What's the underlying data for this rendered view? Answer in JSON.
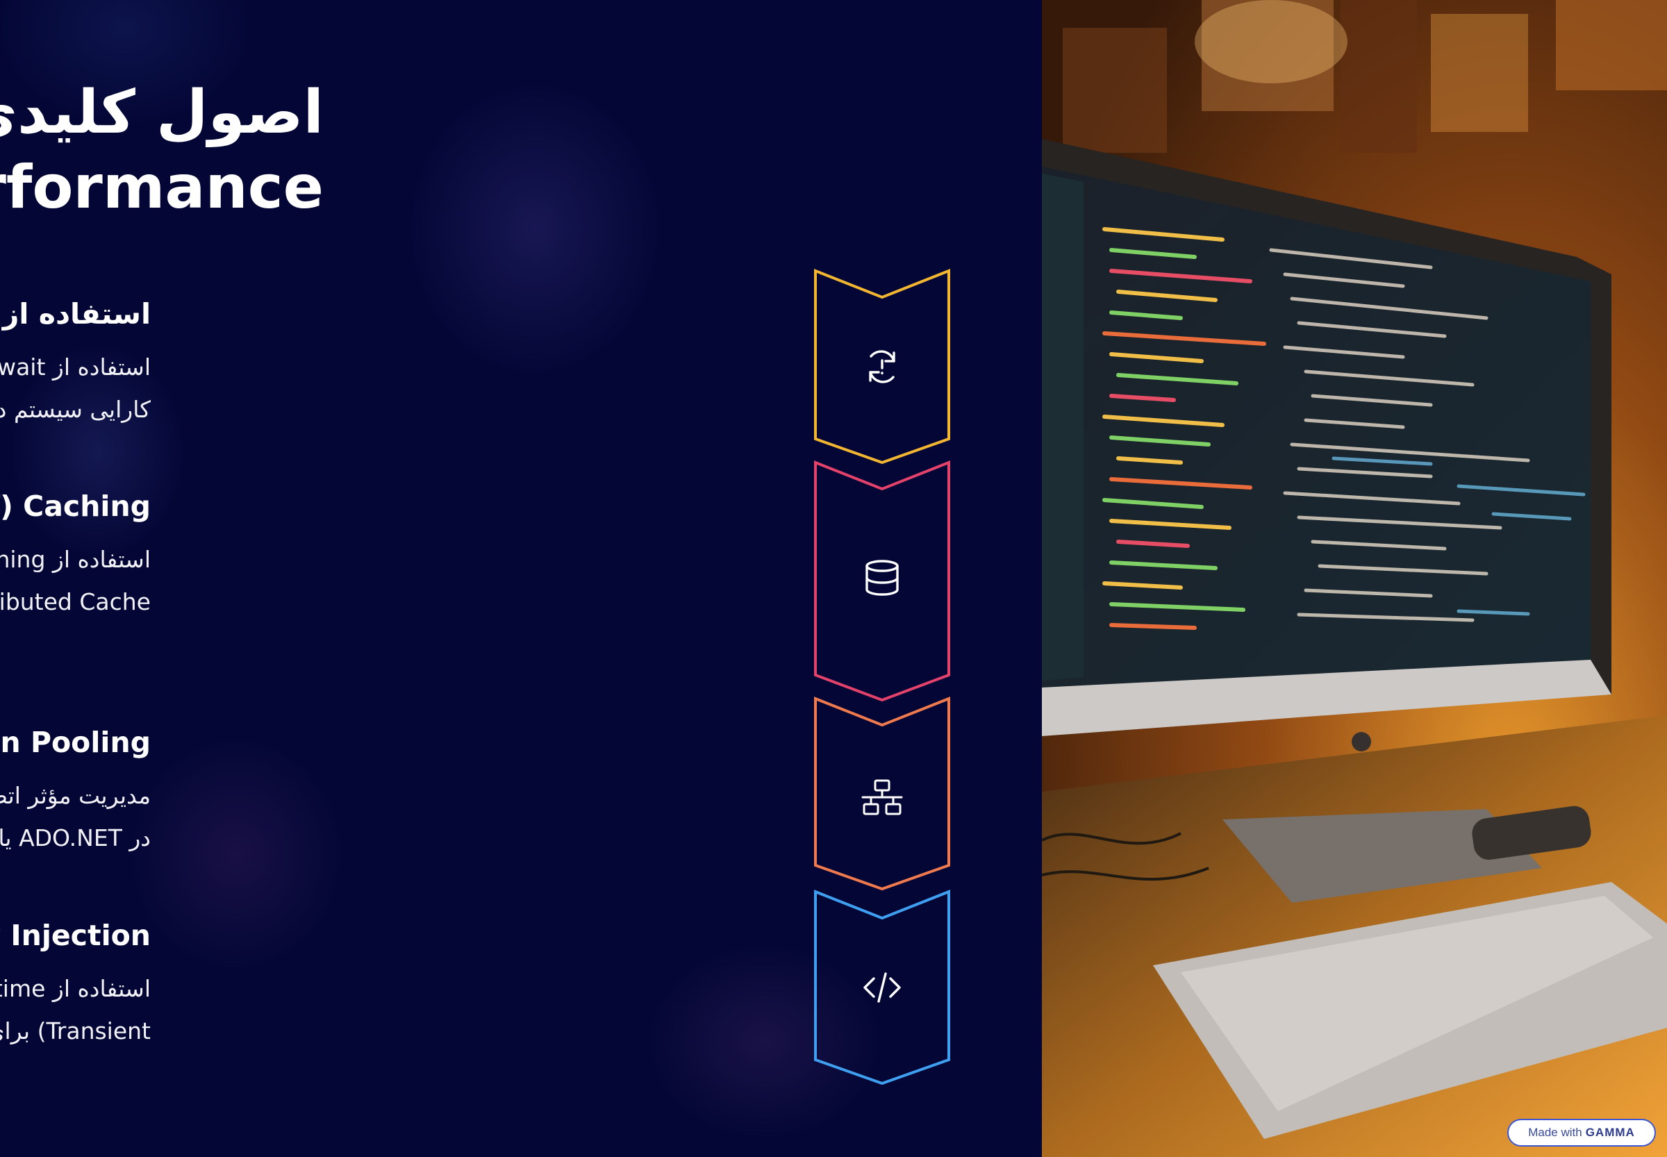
{
  "title": "اصول کلیدی بهبود Performance در .NET",
  "items": [
    {
      "heading": "استفاده از Asynchronous Programming",
      "body": "استفاده از async/await برای بهبود responsiveness و افزایش کارایی سیستم در هنگام انجام عملیات‌های زمان‌بر",
      "icon": "refresh-alert-icon",
      "color": "#f2b631"
    },
    {
      "heading": "Caching (کش کردن داده‌ها)",
      "body": "استفاده از in-memory caching مانند MemoryCache یا Distributed Cache برای کاهش زمان پاسخ‌گویی و بار روی دیتابیس",
      "icon": "database-icon",
      "color": "#e3426a"
    },
    {
      "heading": "Connection Pooling",
      "body": "مدیریت مؤثر اتصال‌ها به پایگاه‌داده با استفاده از connection pooling در ADO.NET یا EF Core",
      "icon": "network-icon",
      "color": "#ef7a4d"
    },
    {
      "heading": "Dependency Injection مناسب",
      "body": "استفاده از lifetime مناسب برای سرویس‌ها (Singleton, Scoped, Transient) برای مصرف بهینه منابع",
      "icon": "code-icon",
      "color": "#3f9ff0"
    }
  ],
  "badge": {
    "prefix": "Made with",
    "brand": "GAMMA"
  }
}
